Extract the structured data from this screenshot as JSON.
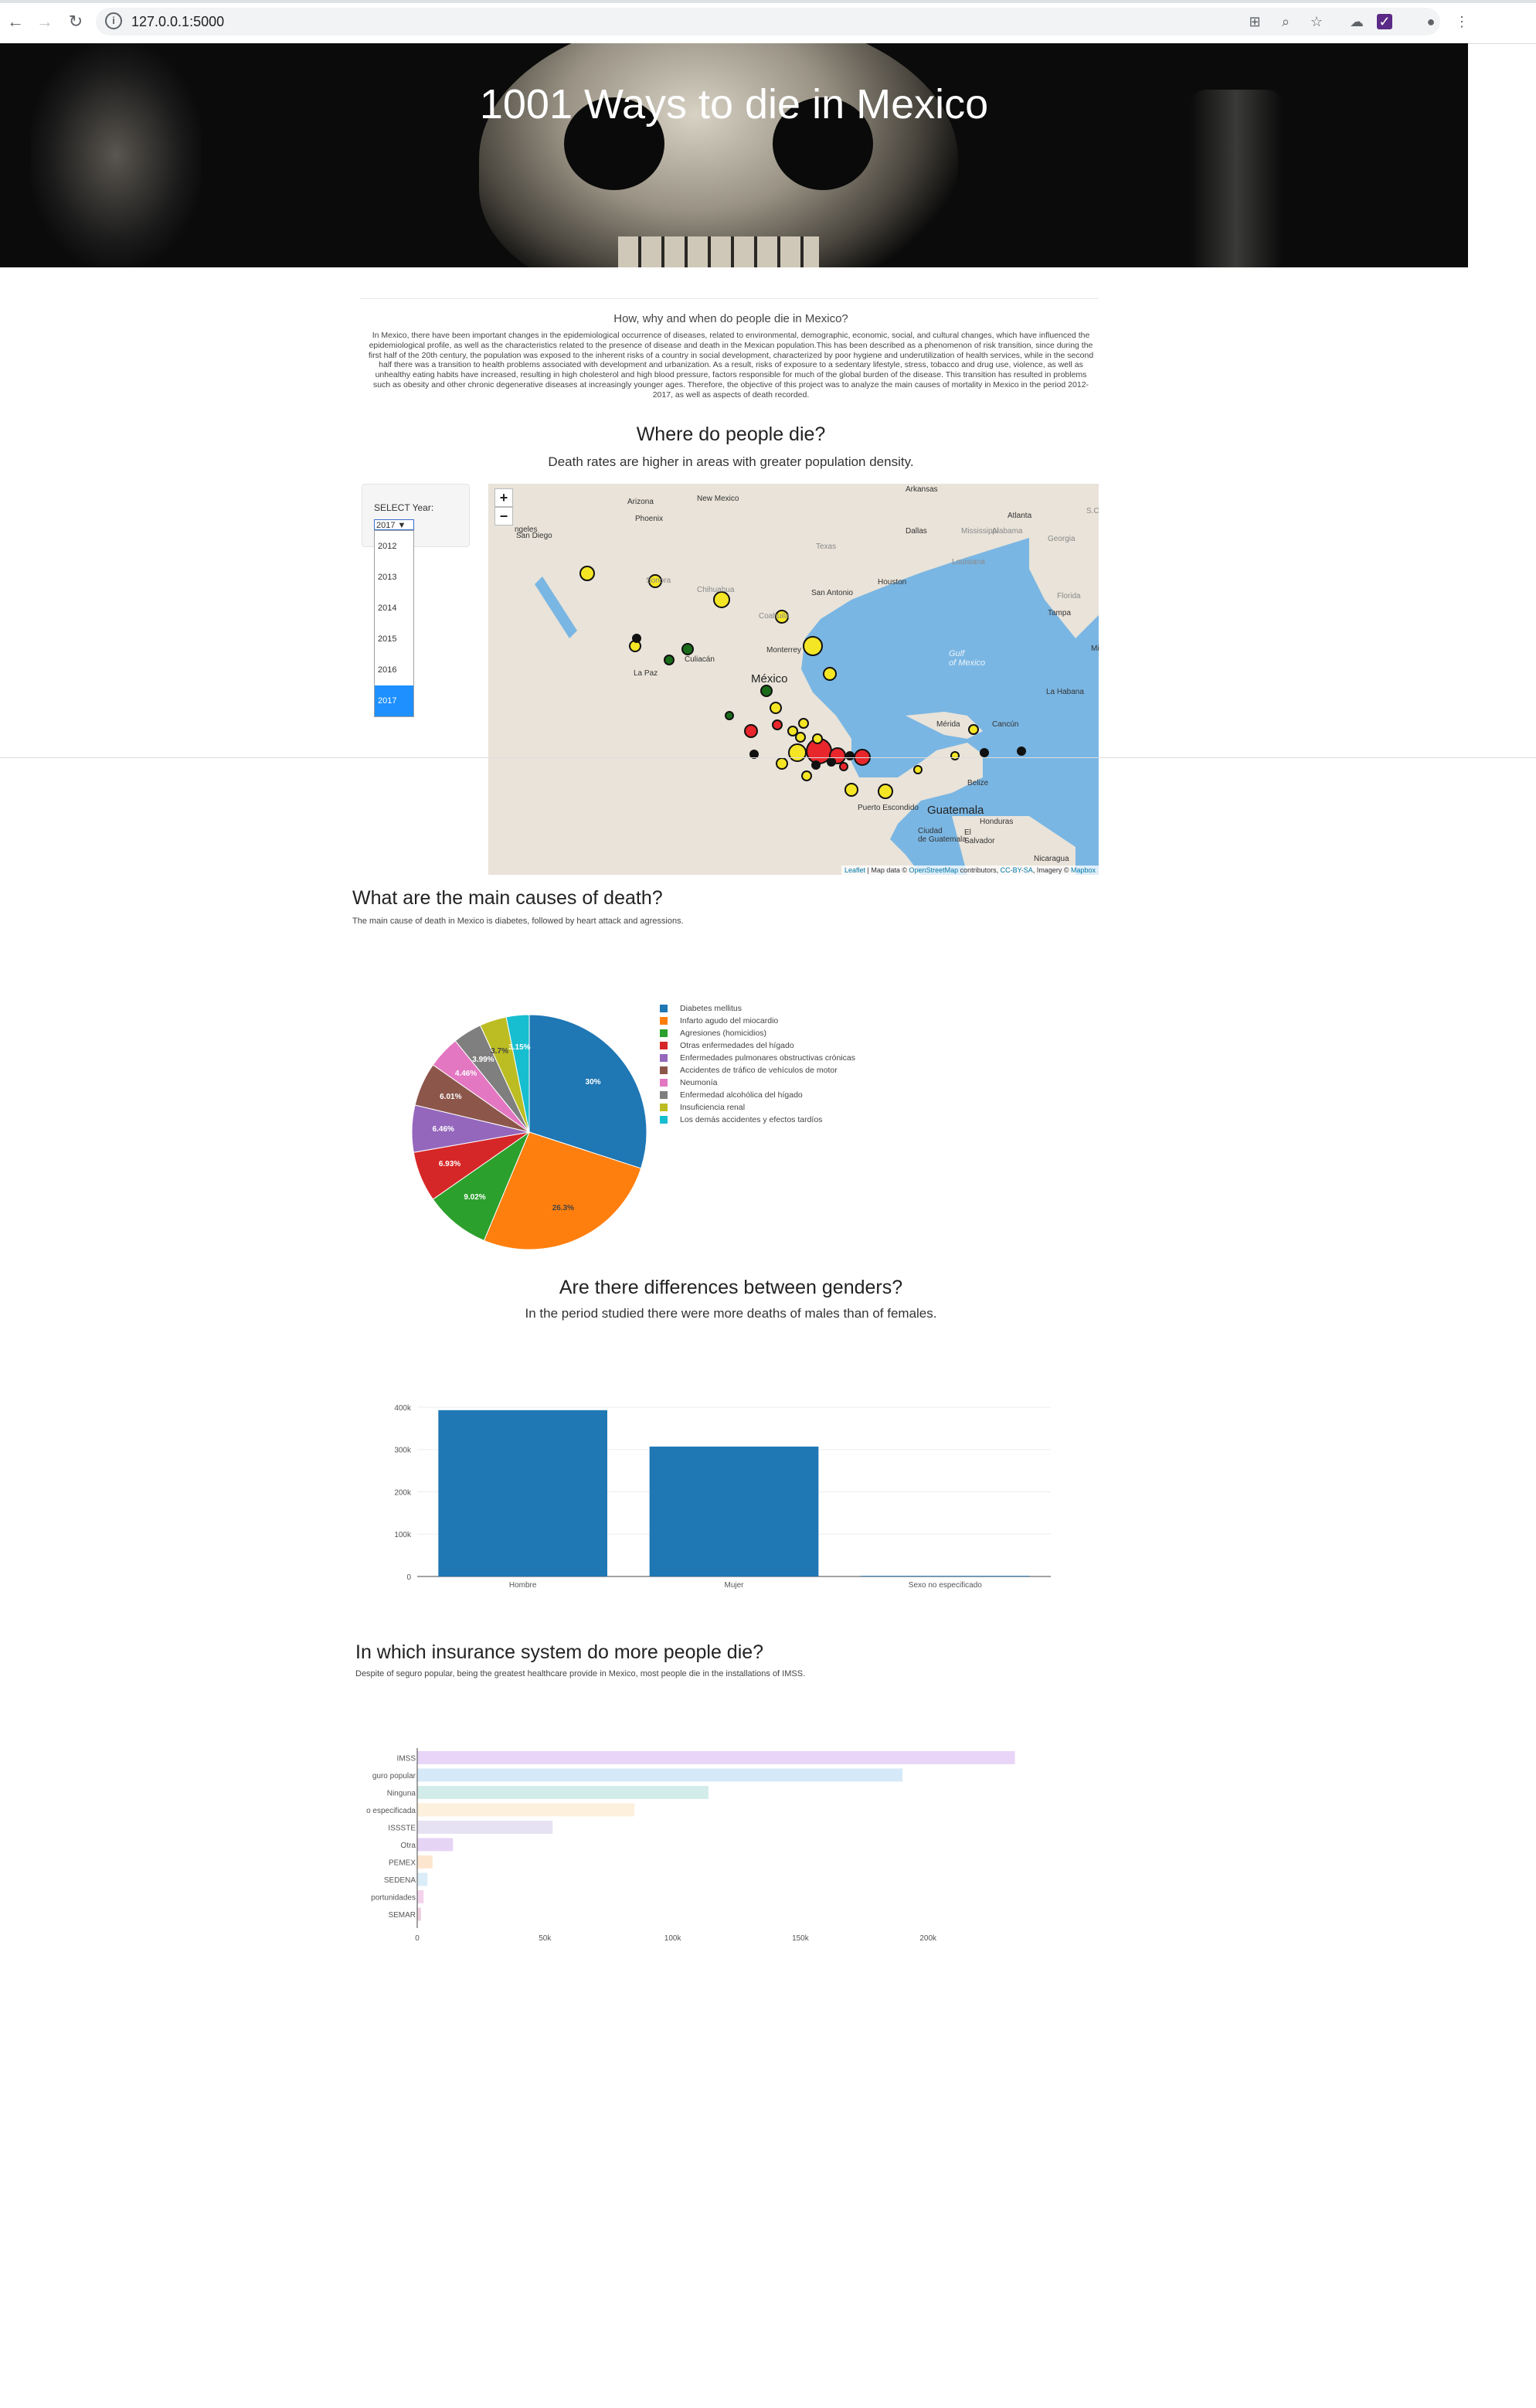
{
  "browser": {
    "url": "127.0.0.1:5000",
    "icons": [
      "back-icon",
      "forward-icon",
      "reload-icon",
      "info-icon",
      "translate-icon",
      "zoom-icon",
      "star-icon",
      "cloud-extension-icon",
      "purple-extension-icon",
      "account-icon",
      "menu-icon"
    ]
  },
  "hero": {
    "title": "1001 Ways to die in Mexico"
  },
  "intro": {
    "question": "How, why and when do people die in Mexico?",
    "paragraph": "In Mexico, there have been important changes in the epidemiological occurrence of diseases, related to environmental, demographic, economic, social, and cultural changes, which have influenced the epidemiological profile, as well as the characteristics related to the presence of disease and death in the Mexican population.This has been described as a phenomenon of risk transition, since during the first half of the 20th century, the population was exposed to the inherent risks of a country in social development, characterized by poor hygiene and underutilization of health services, while in the second half there was a transition to health problems associated with development and urbanization. As a result, risks of exposure to a sedentary lifestyle, stress, tobacco and drug use, violence, as well as unhealthy eating habits have increased, resulting in high cholesterol and high blood pressure, factors responsible for much of the global burden of the disease. This transition has resulted in problems such as obesity and other chronic degenerative diseases at increasingly younger ages. Therefore, the objective of this project was to analyze the main causes of mortality in Mexico in the period 2012-2017, as well as aspects of death recorded."
  },
  "where": {
    "title": "Where do people die?",
    "subtitle": "Death rates are higher in areas with greater population density.",
    "year_label": "SELECT Year:",
    "year_selected": "2017 ▼",
    "years": [
      "2012",
      "2013",
      "2014",
      "2015",
      "2016",
      "2017"
    ],
    "selected_index": 5
  },
  "map": {
    "zoom_in": "+",
    "zoom_out": "−",
    "labels": {
      "arizona": "Arizona",
      "new_mexico": "New Mexico",
      "arkansas": "Arkansas",
      "phoenix": "Phoenix",
      "san_diego": "San Diego",
      "angeles": "ngeles",
      "dallas": "Dallas",
      "atlanta": "Atlanta",
      "mississippi": "Mississippi",
      "alabama": "Alabama",
      "georgia": "Georgia",
      "sc": "S.C",
      "texas": "Texas",
      "louisiana": "Louisiana",
      "houston": "Houston",
      "san_antonio": "San Antonio",
      "florida": "Florida",
      "tampa": "Tampa",
      "miami": "Miam",
      "gulf": "Gulf\nof Mexico",
      "chihuahua": "Chihuahua",
      "sonora": "Sonora",
      "coahuila": "Coahuila",
      "monterrey": "Monterrey",
      "mexico": "México",
      "culiacan": "Culiacán",
      "la_paz": "La Paz",
      "la_habana": "La Habana",
      "merida": "Mérida",
      "cancun": "Cancún",
      "puerto_escondido": "Puerto Escondido",
      "guatemala": "Guatemala",
      "belize": "Belize",
      "honduras": "Honduras",
      "ciudad_guatemala": "Ciudad\nde Guatemala",
      "el_salvador": "El\nSalvador",
      "nicaragua": "Nicaragua"
    },
    "attribution_prefix": "Leaflet",
    "attribution_mid": " | Map data © ",
    "attribution_osm": "OpenStreetMap",
    "attribution_rest": " contributors, ",
    "attribution_cc": "CC-BY-SA",
    "attribution_imagery": ", Imagery © ",
    "attribution_mapbox": "Mapbox",
    "marker_colors": {
      "high": "#e8262b",
      "mid": "#f5e625",
      "low": "#1a6b1a",
      "min": "#111111"
    }
  },
  "causes": {
    "title": "What are the main causes of death?",
    "subtitle": "The main cause of death in Mexico is diabetes, followed by heart attack and agressions."
  },
  "gender": {
    "title": "Are there differences between genders?",
    "subtitle": "In the period studied there were more deaths of males than of females."
  },
  "insurance": {
    "title": "In which insurance system do more people die?",
    "subtitle": "Despite of seguro popular, being the greatest healthcare provide in Mexico, most people die in the installations of IMSS."
  },
  "chart_data": [
    {
      "type": "pie",
      "labels": [
        "Diabetes mellitus",
        "Infarto agudo del miocardio",
        "Agresiones (homicidios)",
        "Otras enfermedades del hígado",
        "Enfermedades pulmonares obstructivas crónicas",
        "Accidentes de tráfico de vehículos de motor",
        "Neumonía",
        "Enfermedad alcohólica del hígado",
        "Insuficiencia renal",
        "Los demás accidentes y efectos tardíos"
      ],
      "values": [
        30,
        26.3,
        9.02,
        6.93,
        6.46,
        6.01,
        4.46,
        3.99,
        3.7,
        3.15
      ],
      "value_labels": [
        "30%",
        "26.3%",
        "9.02%",
        "6.93%",
        "6.46%",
        "6.01%",
        "4.46%",
        "3.99%",
        "3.7%",
        "3.15%"
      ],
      "colors": [
        "#1f77b4",
        "#ff7f0e",
        "#2ca02c",
        "#d62728",
        "#9467bd",
        "#8c564b",
        "#e377c2",
        "#7f7f7f",
        "#bcbd22",
        "#17becf"
      ],
      "legend": "right"
    },
    {
      "type": "bar",
      "categories": [
        "Hombre",
        "Mujer",
        "Sexo no especificado"
      ],
      "values": [
        393000,
        307000,
        1500
      ],
      "ylim": [
        0,
        420000
      ],
      "yticks": [
        0,
        100000,
        200000,
        300000,
        400000
      ],
      "ytick_labels": [
        "0",
        "100k",
        "200k",
        "300k",
        "400k"
      ],
      "color": "#1f77b4",
      "grid": true
    },
    {
      "type": "bar",
      "orientation": "horizontal",
      "categories": [
        "IMSS",
        "guro popular",
        "Ninguna",
        "o especificada",
        "ISSSTE",
        "Otra",
        "PEMEX",
        "SEDENA",
        "portunidades",
        "SEMAR"
      ],
      "values": [
        234000,
        190000,
        114000,
        85000,
        53000,
        14000,
        6000,
        4000,
        2500,
        1500
      ],
      "xlim": [
        0,
        245000
      ],
      "xticks": [
        0,
        50000,
        100000,
        150000,
        200000
      ],
      "xtick_labels": [
        "0",
        "50k",
        "100k",
        "150k",
        "200k"
      ],
      "colors": [
        "#e8d5f7",
        "#d6e9f8",
        "#d2ede9",
        "#fdf0dc",
        "#e6e1f3",
        "#e6d4f5",
        "#fde6cf",
        "#d9ecf8",
        "#f3d2ec",
        "#efd0e0"
      ]
    }
  ]
}
